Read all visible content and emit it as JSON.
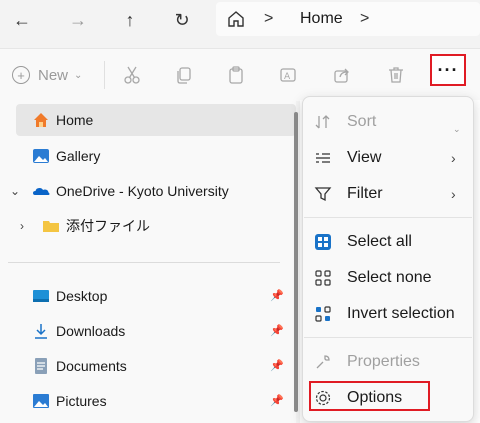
{
  "address_bar": {
    "separator": ">",
    "crumb": "Home"
  },
  "toolbar": {
    "new_label": "New",
    "more_label": "···"
  },
  "sidebar": {
    "items": [
      {
        "label": "Home",
        "icon": "home-icon"
      },
      {
        "label": "Gallery",
        "icon": "gallery-icon"
      },
      {
        "label": "OneDrive - Kyoto University",
        "icon": "onedrive-icon"
      },
      {
        "label": "添付ファイル",
        "icon": "folder-icon"
      },
      {
        "label": "Desktop",
        "icon": "desktop-icon"
      },
      {
        "label": "Downloads",
        "icon": "download-icon"
      },
      {
        "label": "Documents",
        "icon": "documents-icon"
      },
      {
        "label": "Pictures",
        "icon": "pictures-icon"
      }
    ]
  },
  "menu": {
    "items": [
      {
        "label": "Sort",
        "icon": "sort-icon"
      },
      {
        "label": "View",
        "icon": "view-icon"
      },
      {
        "label": "Filter",
        "icon": "filter-icon"
      },
      {
        "label": "Select all",
        "icon": "select-all-icon"
      },
      {
        "label": "Select none",
        "icon": "select-none-icon"
      },
      {
        "label": "Invert selection",
        "icon": "invert-selection-icon"
      },
      {
        "label": "Properties",
        "icon": "properties-icon"
      },
      {
        "label": "Options",
        "icon": "options-icon"
      }
    ]
  },
  "colors": {
    "accent_red": "#e01b24",
    "folder_yellow": "#f4c542",
    "onedrive_blue": "#0a64c8"
  }
}
